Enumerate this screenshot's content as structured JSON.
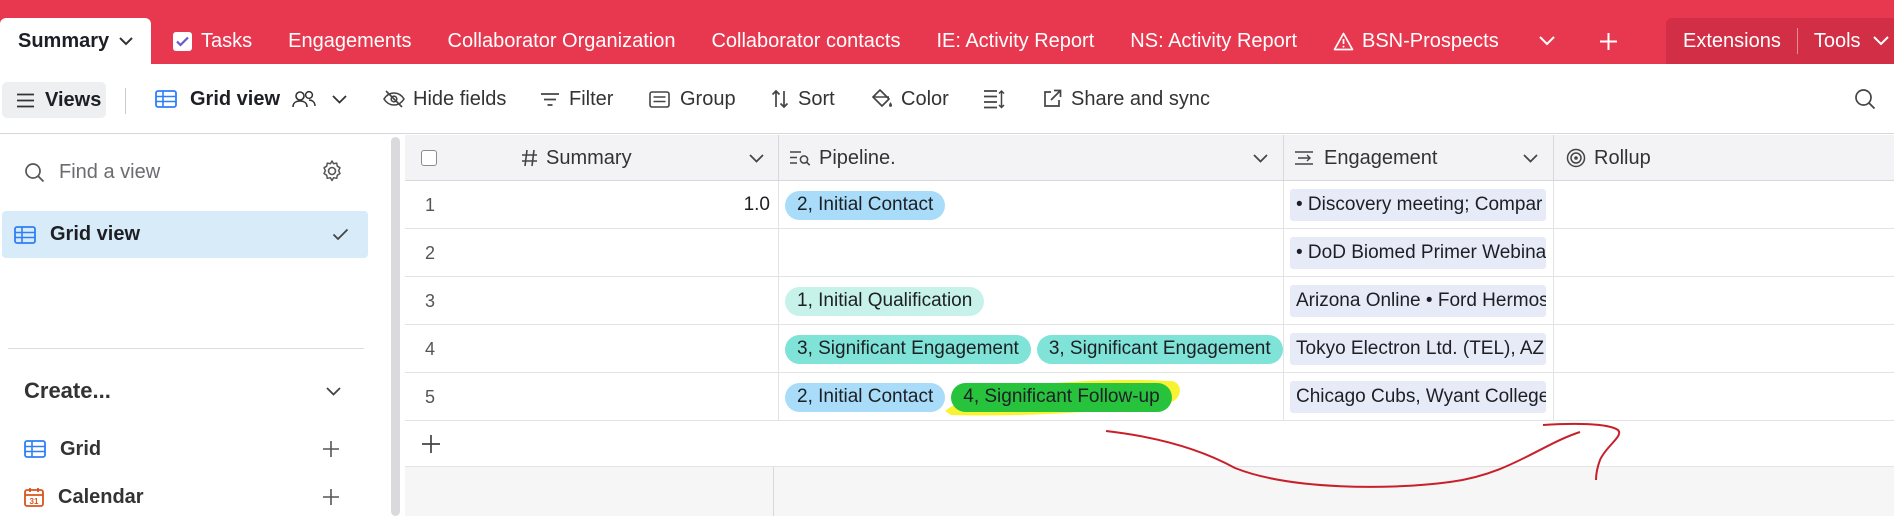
{
  "tabs": {
    "active": "Summary",
    "items": [
      {
        "label": "Tasks"
      },
      {
        "label": "Engagements"
      },
      {
        "label": "Collaborator Organization"
      },
      {
        "label": "Collaborator contacts"
      },
      {
        "label": "IE: Activity Report"
      },
      {
        "label": "NS: Activity Report"
      },
      {
        "label": "BSN-Prospects"
      }
    ],
    "extensions": "Extensions",
    "tools": "Tools"
  },
  "toolbar": {
    "views": "Views",
    "grid_view": "Grid view",
    "hide_fields": "Hide fields",
    "filter": "Filter",
    "group": "Group",
    "sort": "Sort",
    "color": "Color",
    "share_sync": "Share and sync"
  },
  "sidebar": {
    "search_placeholder": "Find a view",
    "selected_view": "Grid view",
    "create_label": "Create...",
    "create_items": [
      {
        "label": "Grid"
      },
      {
        "label": "Calendar"
      }
    ]
  },
  "grid": {
    "columns": [
      "Summary",
      "Pipeline.",
      "Engagement",
      "Rollup"
    ],
    "rows": [
      {
        "num": "1",
        "summary": "1.0",
        "pipeline": [
          "2, Initial Contact"
        ],
        "engagement": "• Discovery meeting; Compar"
      },
      {
        "num": "2",
        "summary": "",
        "pipeline": [],
        "engagement": "• DoD Biomed Primer Webina"
      },
      {
        "num": "3",
        "summary": "",
        "pipeline": [
          "1, Initial Qualification"
        ],
        "engagement": "Arizona Online • Ford Hermos"
      },
      {
        "num": "4",
        "summary": "",
        "pipeline": [
          "3, Significant Engagement",
          "3, Significant Engagement"
        ],
        "engagement": "Tokyo Electron Ltd. (TEL), AZ T"
      },
      {
        "num": "5",
        "summary": "",
        "pipeline": [
          "2, Initial Contact",
          "4, Significant Follow-up"
        ],
        "engagement": "Chicago Cubs, Wyant College"
      }
    ]
  },
  "colors": {
    "brand": "#e8384f",
    "pill_blue": "#a8dcf8",
    "pill_mint": "#c6f2ea",
    "pill_teal": "#7fe3d7",
    "highlight_yellow": "#f6f21c",
    "annotation_red": "#c8202a",
    "selected_view_bg": "#d7ecf8"
  }
}
